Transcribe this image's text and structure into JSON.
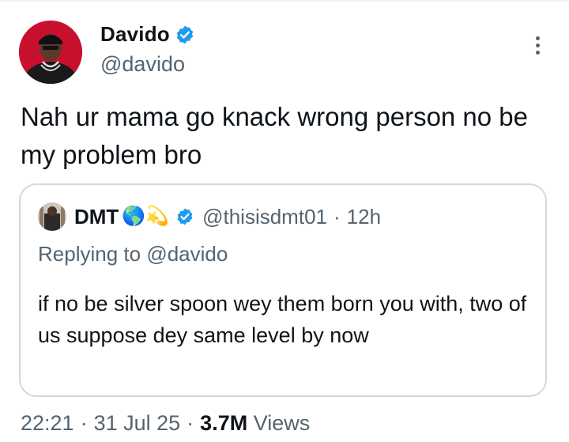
{
  "author": {
    "display_name": "Davido",
    "handle": "@davido",
    "verified": true,
    "avatar_icon": "profile-photo"
  },
  "tweet": {
    "text": "Nah ur mama go knack wrong person no be my problem bro",
    "time": "22:21",
    "date": "31 Jul 25",
    "views_count": "3.7M",
    "views_label": "Views"
  },
  "quoted": {
    "display_name": "DMT",
    "emojis": "🌎💫",
    "verified": true,
    "handle": "@thisisdmt01",
    "time_ago": "12h",
    "replying_prefix": "Replying to",
    "replying_to": "@davido",
    "text": "if no be silver spoon wey them born you with, two of us suppose dey same level by now"
  },
  "colors": {
    "text": "#0f1419",
    "secondary": "#536471",
    "verified": "#1d9bf0",
    "border": "#cfd9de"
  },
  "icons": {
    "more": "more-vertical-icon",
    "verified": "verified-badge-icon"
  }
}
